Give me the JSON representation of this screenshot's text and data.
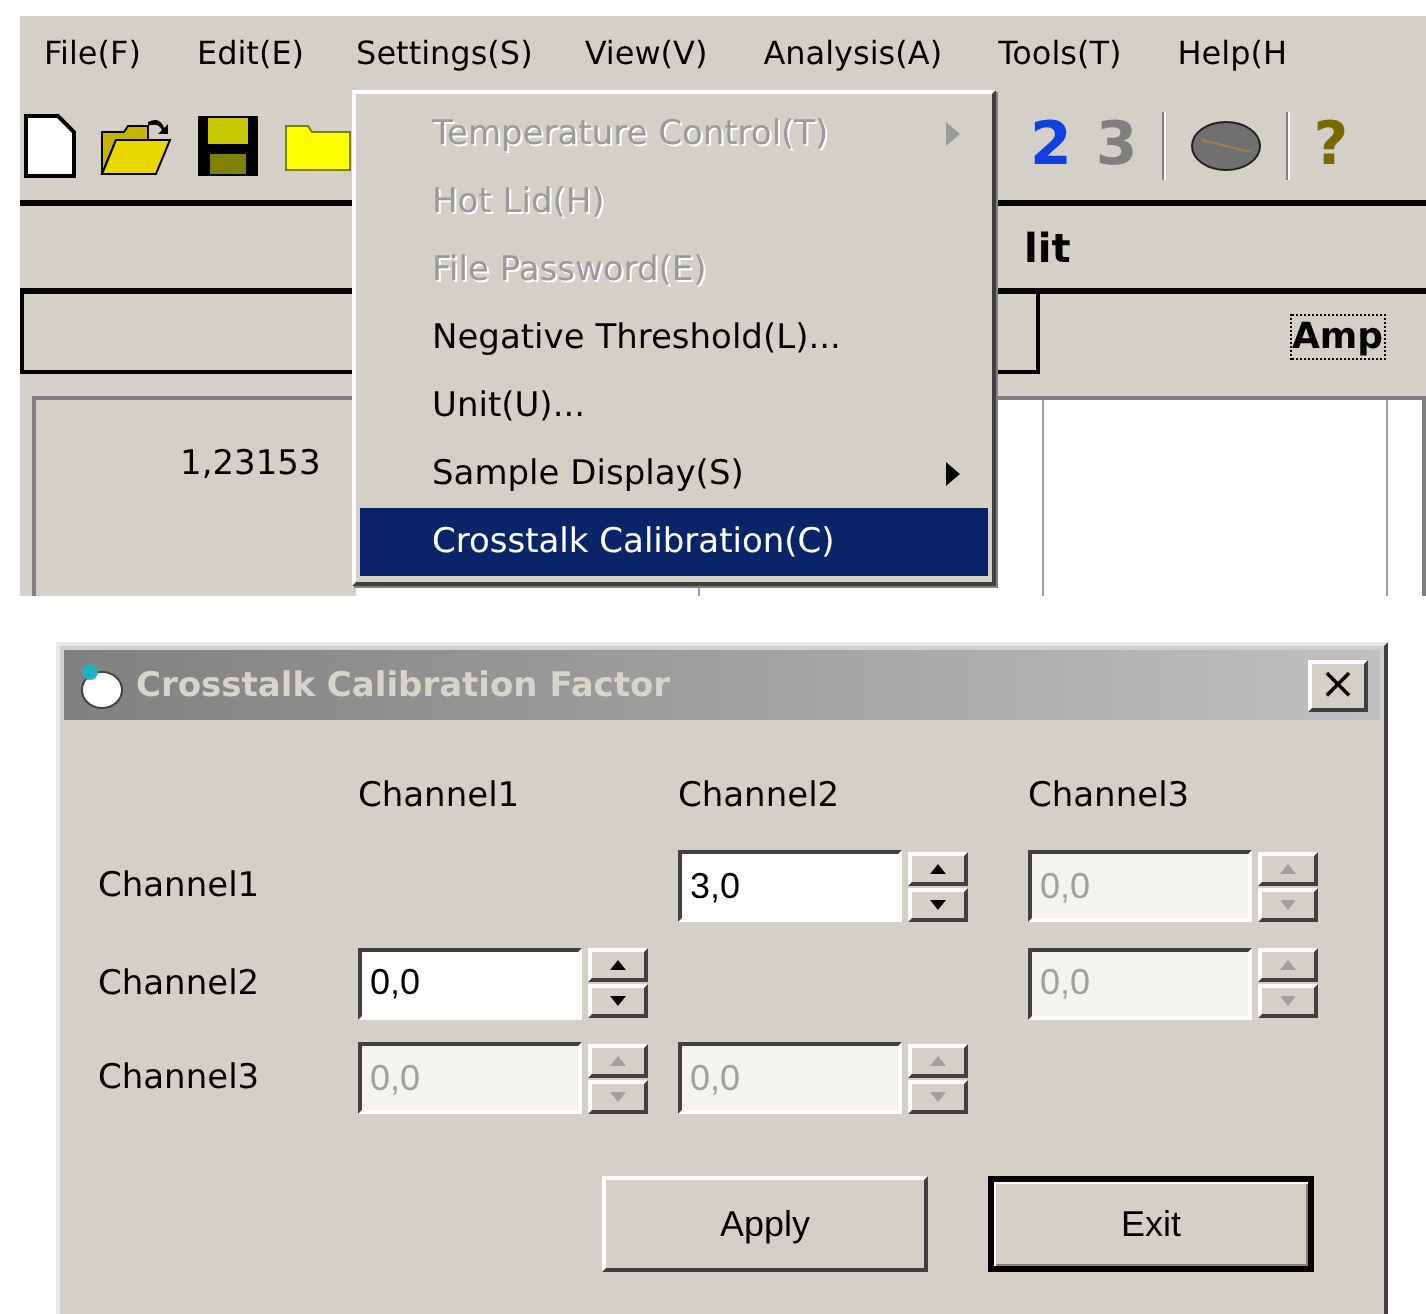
{
  "menu_bar": [
    {
      "label": "File(F)",
      "selected": false
    },
    {
      "label": "Edit(E)",
      "selected": false
    },
    {
      "label": "Settings(S)",
      "selected": true
    },
    {
      "label": "View(V)",
      "selected": false
    },
    {
      "label": "Analysis(A)",
      "selected": false
    },
    {
      "label": "Tools(T)",
      "selected": false
    },
    {
      "label": "Help(H",
      "selected": false
    }
  ],
  "toolbar_labels": [
    "2",
    "3",
    "?"
  ],
  "background": {
    "panel_title": "lit",
    "tab_label": "Amp",
    "cell_value": "1,23153"
  },
  "settings_menu": [
    {
      "label": "Temperature Control(T)",
      "disabled": true,
      "submenu": true,
      "selected": false
    },
    {
      "label": "Hot Lid(H)",
      "disabled": true,
      "submenu": false,
      "selected": false
    },
    {
      "label": "File Password(E)",
      "disabled": true,
      "submenu": false,
      "selected": false
    },
    {
      "label": "Negative Threshold(L)...",
      "disabled": false,
      "submenu": false,
      "selected": false
    },
    {
      "label": "Unit(U)...",
      "disabled": false,
      "submenu": false,
      "selected": false
    },
    {
      "label": "Sample Display(S)",
      "disabled": false,
      "submenu": true,
      "selected": false
    },
    {
      "label": "Crosstalk Calibration(C)",
      "disabled": false,
      "submenu": false,
      "selected": true
    }
  ],
  "dialog": {
    "title": "Crosstalk Calibration Factor",
    "close": "×",
    "column_headers": [
      "Channel1",
      "Channel2",
      "Channel3"
    ],
    "rows": [
      {
        "label": "Channel1",
        "cells": [
          {
            "kind": "empty"
          },
          {
            "kind": "spin",
            "value": "3,0",
            "disabled": false
          },
          {
            "kind": "spin",
            "value": "0,0",
            "disabled": true
          }
        ]
      },
      {
        "label": "Channel2",
        "cells": [
          {
            "kind": "spin",
            "value": "0,0",
            "disabled": false
          },
          {
            "kind": "empty"
          },
          {
            "kind": "spin",
            "value": "0,0",
            "disabled": true
          }
        ]
      },
      {
        "label": "Channel3",
        "cells": [
          {
            "kind": "spin",
            "value": "0,0",
            "disabled": true
          },
          {
            "kind": "spin",
            "value": "0,0",
            "disabled": true
          },
          {
            "kind": "empty"
          }
        ]
      }
    ],
    "buttons": [
      {
        "label": "Apply",
        "default": false
      },
      {
        "label": "Exit",
        "default": true
      }
    ]
  }
}
